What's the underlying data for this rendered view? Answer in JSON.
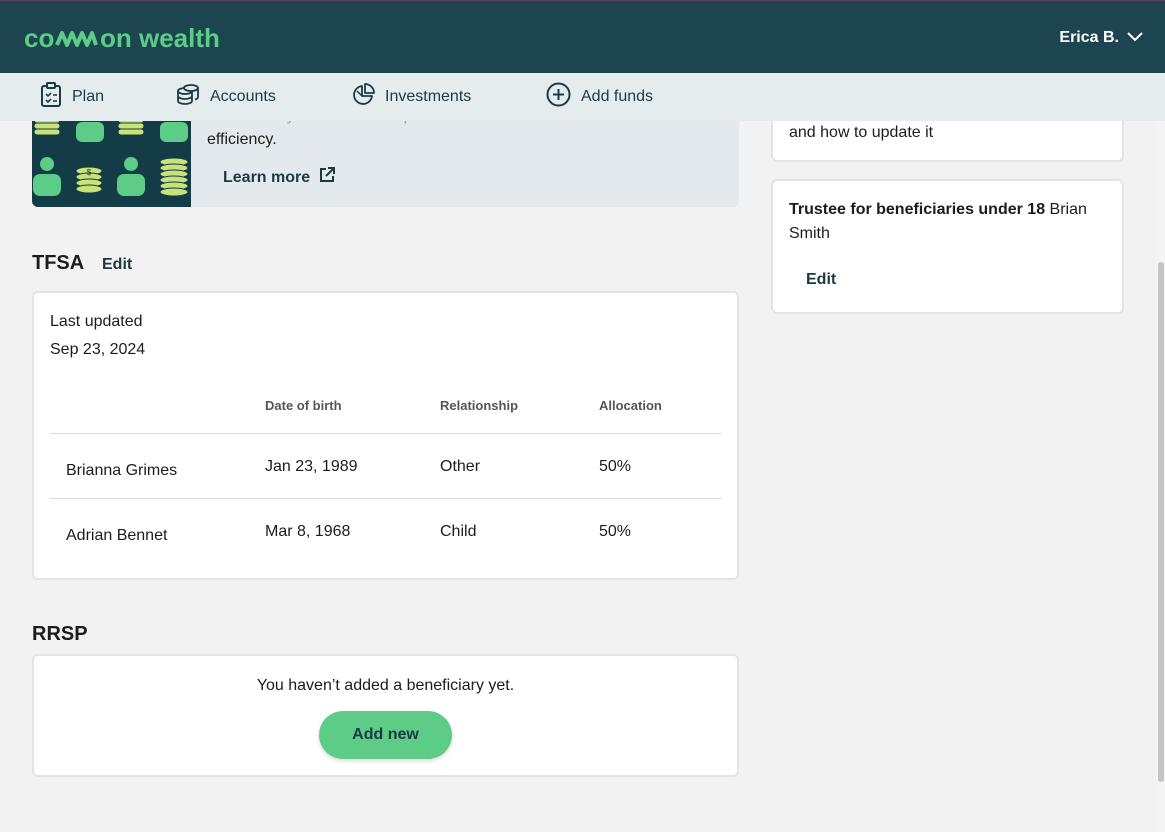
{
  "app": {
    "logo_text": "common wealth"
  },
  "header": {
    "user_name": "Erica B."
  },
  "nav": {
    "items": [
      {
        "label": "Plan",
        "icon": "clipboard-icon"
      },
      {
        "label": "Accounts",
        "icon": "coins-stack-icon"
      },
      {
        "label": "Investments",
        "icon": "pie-chart-icon"
      },
      {
        "label": "Add funds",
        "icon": "plus-circle-icon"
      }
    ]
  },
  "banner": {
    "partial_line": "…rtaxes…y…ore…s…e…p…ersonal…ect…o…eff…ic…te",
    "text_last": "efficiency.",
    "learn_more": "Learn more"
  },
  "tfsa": {
    "title": "TFSA",
    "edit": "Edit",
    "last_updated_label": "Last updated",
    "last_updated_date": "Sep 23, 2024",
    "columns": [
      "",
      "Date of birth",
      "Relationship",
      "Allocation"
    ],
    "rows": [
      {
        "name": "Brianna Grimes",
        "dob": "Jan 23, 1989",
        "relationship": "Other",
        "allocation": "50%"
      },
      {
        "name": "Adrian Bennet",
        "dob": "Mar 8, 1968",
        "relationship": "Child",
        "allocation": "50%"
      }
    ]
  },
  "rrsp": {
    "title": "RRSP",
    "empty_message": "You haven’t added a beneficiary yet.",
    "add_new": "Add new"
  },
  "right": {
    "top_card_tail": "and how to update it",
    "trustee_label": "Trustee for beneficiaries under 18",
    "trustee_name_1": "Brian",
    "trustee_name_2": "Smith",
    "edit": "Edit"
  },
  "colors": {
    "header_bg": "#1c4550",
    "nav_bg": "#e5ecee",
    "brand_green": "#5ccc86",
    "link": "#1c3a44"
  }
}
